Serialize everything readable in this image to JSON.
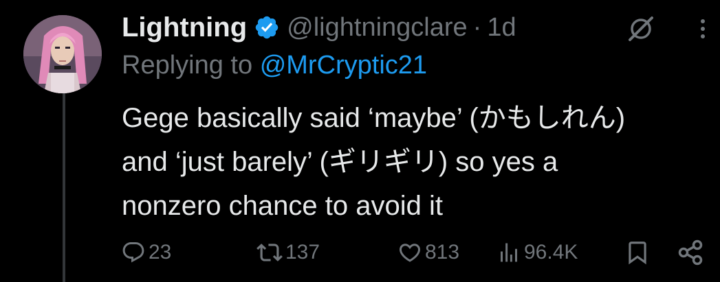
{
  "tweet": {
    "display_name": "Lightning",
    "handle": "@lightningclare",
    "separator": "·",
    "time": "1d",
    "replying_prefix": "Replying to",
    "replying_to": "@MrCryptic21",
    "text_lines": [
      "Gege basically said ‘maybe’ (かもしれん)",
      "and ‘just barely’ (ギリギリ) so yes a",
      "nonzero chance to avoid it"
    ]
  },
  "actions": {
    "replies": "23",
    "reposts": "137",
    "likes": "813",
    "views": "96.4K"
  },
  "icons": {
    "verified": "verified-badge-icon",
    "grok": "grok-icon",
    "more": "more-icon",
    "reply": "reply-icon",
    "repost": "repost-icon",
    "like": "like-icon",
    "views": "views-icon",
    "bookmark": "bookmark-icon",
    "share": "share-icon"
  },
  "colors": {
    "background": "#000000",
    "text": "#e7e9ea",
    "secondary": "#71767b",
    "accent": "#1d9bf0"
  }
}
